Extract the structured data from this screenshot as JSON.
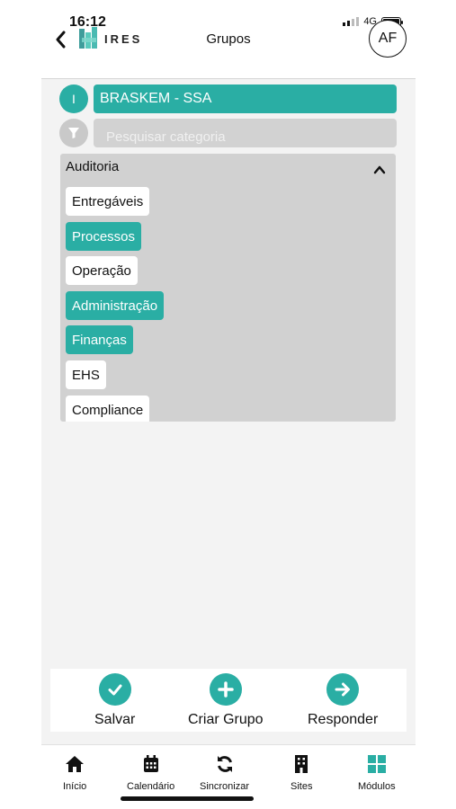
{
  "status_bar": {
    "time": "16:12",
    "network": "4G"
  },
  "header": {
    "logo_text": "IRES",
    "title": "Grupos",
    "avatar_initials": "AF"
  },
  "colors": {
    "accent": "#2aaea4",
    "panel": "#d1d1d1",
    "search_bar": "#d2d2d2"
  },
  "site_selector": {
    "badge": "I",
    "value": "BRASKEM - SSA"
  },
  "search": {
    "placeholder": "Pesquisar categoria",
    "icon": "filter-icon"
  },
  "category_panel": {
    "title": "Auditoria",
    "expanded": true,
    "items": [
      {
        "label": "Entregáveis",
        "selected": false
      },
      {
        "label": "Processos",
        "selected": true
      },
      {
        "label": "Operação",
        "selected": false
      },
      {
        "label": "Administração",
        "selected": true
      },
      {
        "label": "Finanças",
        "selected": true
      },
      {
        "label": "EHS",
        "selected": false
      },
      {
        "label": "Compliance",
        "selected": false
      }
    ]
  },
  "actions": [
    {
      "label": "Salvar",
      "icon": "check-icon"
    },
    {
      "label": "Criar Grupo",
      "icon": "plus-icon"
    },
    {
      "label": "Responder",
      "icon": "arrow-right-icon"
    }
  ],
  "bottom_nav": [
    {
      "label": "Início",
      "icon": "home-icon",
      "active": false
    },
    {
      "label": "Calendário",
      "icon": "calendar-icon",
      "active": false
    },
    {
      "label": "Sincronizar",
      "icon": "sync-icon",
      "active": false
    },
    {
      "label": "Sites",
      "icon": "building-icon",
      "active": false
    },
    {
      "label": "Módulos",
      "icon": "grid-icon",
      "active": true
    }
  ]
}
